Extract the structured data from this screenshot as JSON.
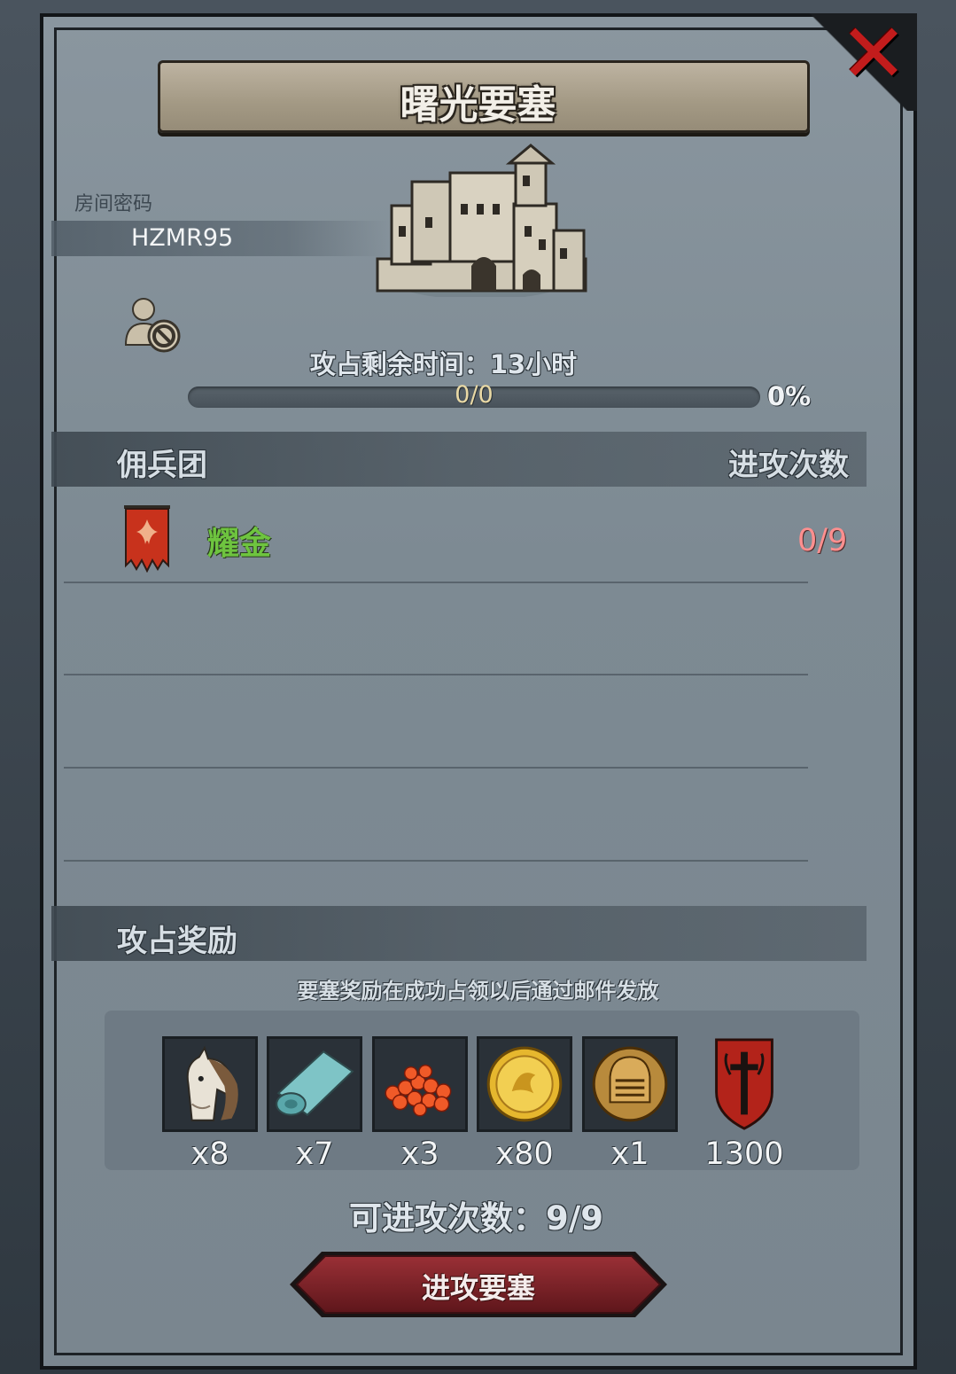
{
  "title": "曙光要塞",
  "room": {
    "password_label": "房间密码",
    "password_value": "HZMR95"
  },
  "icons": {
    "close": "close-icon",
    "user_block": "user-blocked-icon",
    "castle": "fortress-castle-icon",
    "guild_banner": "guild-banner-icon"
  },
  "capture": {
    "time_text": "攻占剩余时间：13小时",
    "progress_text": "0/0",
    "progress_percent_text": "0%",
    "progress_fraction": 0
  },
  "mercenary": {
    "header": "佣兵团",
    "attacks_header": "进攻次数",
    "rows": [
      {
        "name": "耀金",
        "attacks": "0/9"
      }
    ]
  },
  "rewards": {
    "header": "攻占奖励",
    "note": "要塞奖励在成功占领以后通过邮件发放",
    "items": [
      {
        "icon": "horse-icon",
        "qty": "x8"
      },
      {
        "icon": "cloth-roll-icon",
        "qty": "x7"
      },
      {
        "icon": "red-gems-icon",
        "qty": "x3"
      },
      {
        "icon": "gold-coin-icon",
        "qty": "x80"
      },
      {
        "icon": "knight-helmet-coin-icon",
        "qty": "x1"
      },
      {
        "icon": "sword-shield-emblem-icon",
        "qty": "1300"
      }
    ]
  },
  "attacks_left": "可进攻次数：9/9",
  "attack_button": "进攻要塞",
  "colors": {
    "guild_name": "#6ec43f",
    "attack_count": "#ff8f8f",
    "close": "#c21c1c",
    "attack_button": "#7a2226"
  }
}
